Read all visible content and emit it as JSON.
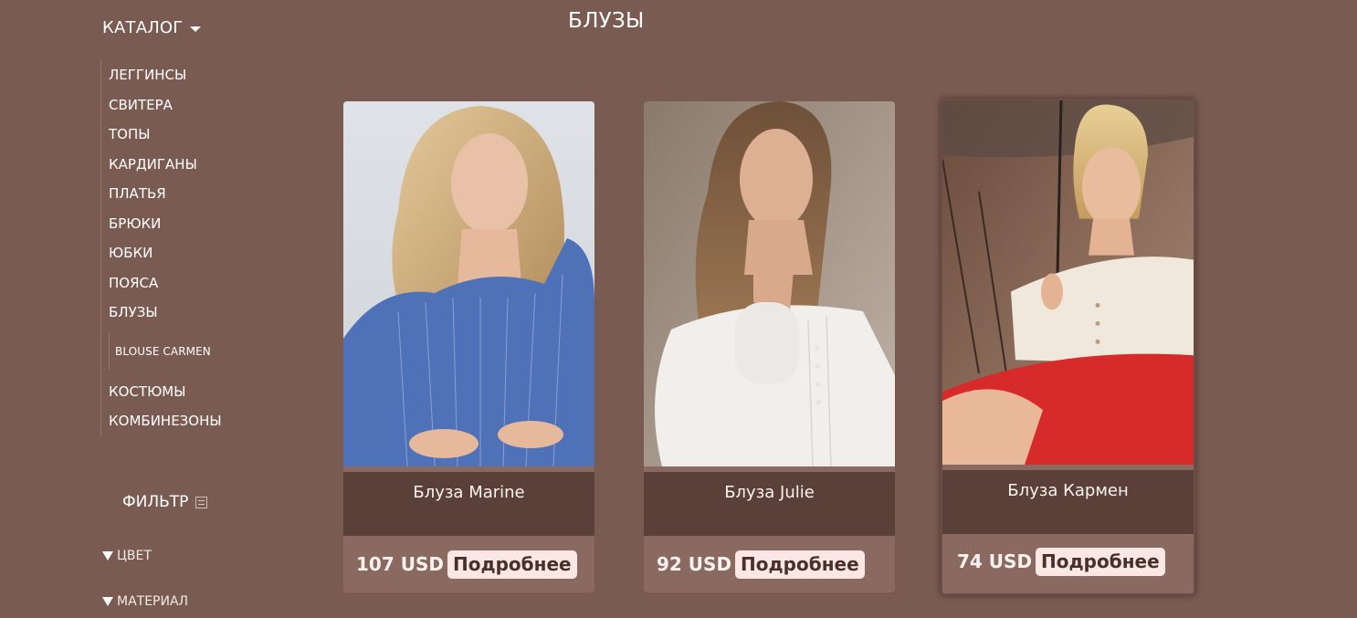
{
  "sidebar": {
    "catalog_label": "КАТАЛОГ",
    "categories": [
      "ЛЕГГИНСЫ",
      "СВИТЕРА",
      "ТОПЫ",
      "КАРДИГАНЫ",
      "ПЛАТЬЯ",
      "БРЮКИ",
      "ЮБКИ",
      "ПОЯСА",
      "БЛУЗЫ"
    ],
    "subcategory": "BLOUSE CARMEN",
    "categories_after": [
      "КОСТЮМЫ",
      "КОМБИНЕЗОНЫ"
    ],
    "filter_label": "ФИЛЬТР",
    "filter_options": [
      "ЦВЕТ",
      "МАТЕРИАЛ"
    ]
  },
  "main": {
    "title": "БЛУЗЫ",
    "products": [
      {
        "name": "Блуза Marine",
        "price": "107 USD",
        "button": "Подробнее"
      },
      {
        "name": "Блуза Julie",
        "price": "92 USD",
        "button": "Подробнее"
      },
      {
        "name": "Блуза Кармен",
        "price": "74 USD",
        "button": "Подробнее"
      }
    ]
  },
  "colors": {
    "background": "#7a5b52",
    "name_band": "#5a4039",
    "button_bg": "#fbe7e3",
    "button_text": "#4a302a"
  }
}
